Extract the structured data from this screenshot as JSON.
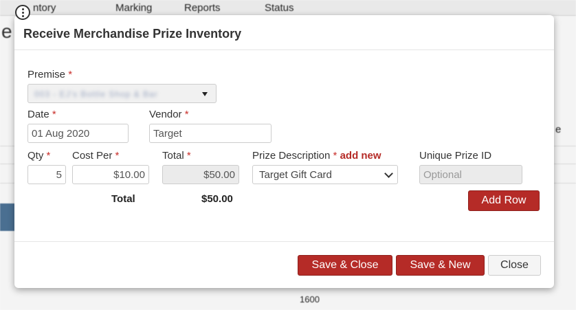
{
  "background": {
    "nav_items": [
      "ntory",
      "Marking",
      "Reports",
      "Status"
    ],
    "text_fragments": [
      "e",
      "e",
      "1600"
    ]
  },
  "modal": {
    "title": "Receive Merchandise Prize Inventory",
    "premise": {
      "label": "Premise",
      "value": "003 - EJ's Bottle Shop & Bar"
    },
    "date": {
      "label": "Date",
      "value": "01 Aug 2020"
    },
    "vendor": {
      "label": "Vendor",
      "value": "Target"
    },
    "columns": {
      "qty": "Qty",
      "cost_per": "Cost Per",
      "total": "Total",
      "prize_description": "Prize Description",
      "add_new": "add new",
      "unique_prize_id": "Unique Prize ID"
    },
    "row": {
      "qty": "5",
      "cost_per": "$10.00",
      "total": "$50.00",
      "prize_description": "Target Gift Card",
      "unique_prize_id_placeholder": "Optional"
    },
    "summary": {
      "label": "Total",
      "value": "$50.00"
    },
    "required_marker": "*",
    "buttons": {
      "add_row": "Add Row",
      "save_close": "Save & Close",
      "save_new": "Save & New",
      "close": "Close"
    }
  },
  "colors": {
    "accent": "#b52b27",
    "required": "#c9302c"
  }
}
